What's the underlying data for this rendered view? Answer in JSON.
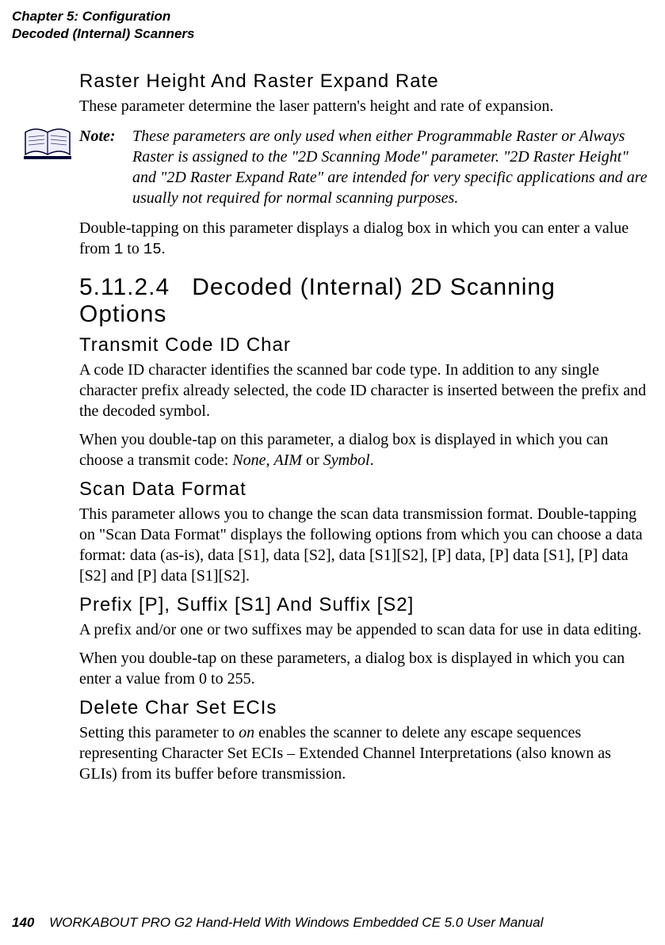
{
  "header": {
    "chapter": "Chapter 5: Configuration",
    "section": "Decoded (Internal) Scanners"
  },
  "sec1": {
    "heading": "Raster Height And Raster Expand Rate",
    "p1": "These parameter determine the laser pattern's height and rate of expansion."
  },
  "note": {
    "label": "Note:",
    "body": "These parameters are only used when either Programmable Raster or Always Raster is assigned to the \"2D Scanning Mode\" parameter. \"2D Raster Height\" and \"2D Raster Expand Rate\" are intended for very specific applications and are usually not required for normal scanning purposes."
  },
  "sec1b": {
    "p_pre": "Double-tapping on this parameter displays a dialog box in which you can enter a value from ",
    "v1": "1",
    "mid": " to ",
    "v2": "15",
    "post": "."
  },
  "sec2": {
    "num": "5.11.2.4",
    "title": "Decoded (Internal) 2D Scanning Options"
  },
  "transmit": {
    "heading": "Transmit Code ID Char",
    "p1": "A code ID character identifies the scanned bar code type. In addition to any single character prefix already selected, the code ID character is inserted between the prefix and the decoded symbol.",
    "p2_pre": "When you double-tap on this parameter, a dialog box is displayed in which you can choose a transmit code: ",
    "opt1": "None",
    "c1": ", ",
    "opt2": "AIM",
    "c2": " or ",
    "opt3": "Symbol",
    "post": "."
  },
  "scandata": {
    "heading": "Scan Data Format",
    "p1": "This parameter allows you to change the scan data transmission format. Double-tapping on \"Scan Data Format\" displays the following options from which you can choose a data format: data (as-is), data [S1], data [S2], data [S1][S2], [P] data, [P] data [S1], [P] data [S2] and [P] data [S1][S2]."
  },
  "prefix": {
    "heading": "Prefix [P], Suffix [S1] And Suffix [S2]",
    "p1": "A prefix and/or one or two suffixes may be appended to scan data for use in data editing.",
    "p2": "When you double-tap on these parameters, a dialog box is displayed in which you can enter a value from 0 to 255."
  },
  "delete": {
    "heading": "Delete Char Set ECIs",
    "p1_pre": "Setting this parameter to ",
    "on": "on",
    "p1_post": " enables the scanner to delete any escape sequences representing Character Set ECIs – Extended Channel Interpretations (also known as GLIs) from its buffer before transmission."
  },
  "footer": {
    "page": "140",
    "title": "WORKABOUT PRO G2 Hand-Held With Windows Embedded CE 5.0 User Manual"
  }
}
